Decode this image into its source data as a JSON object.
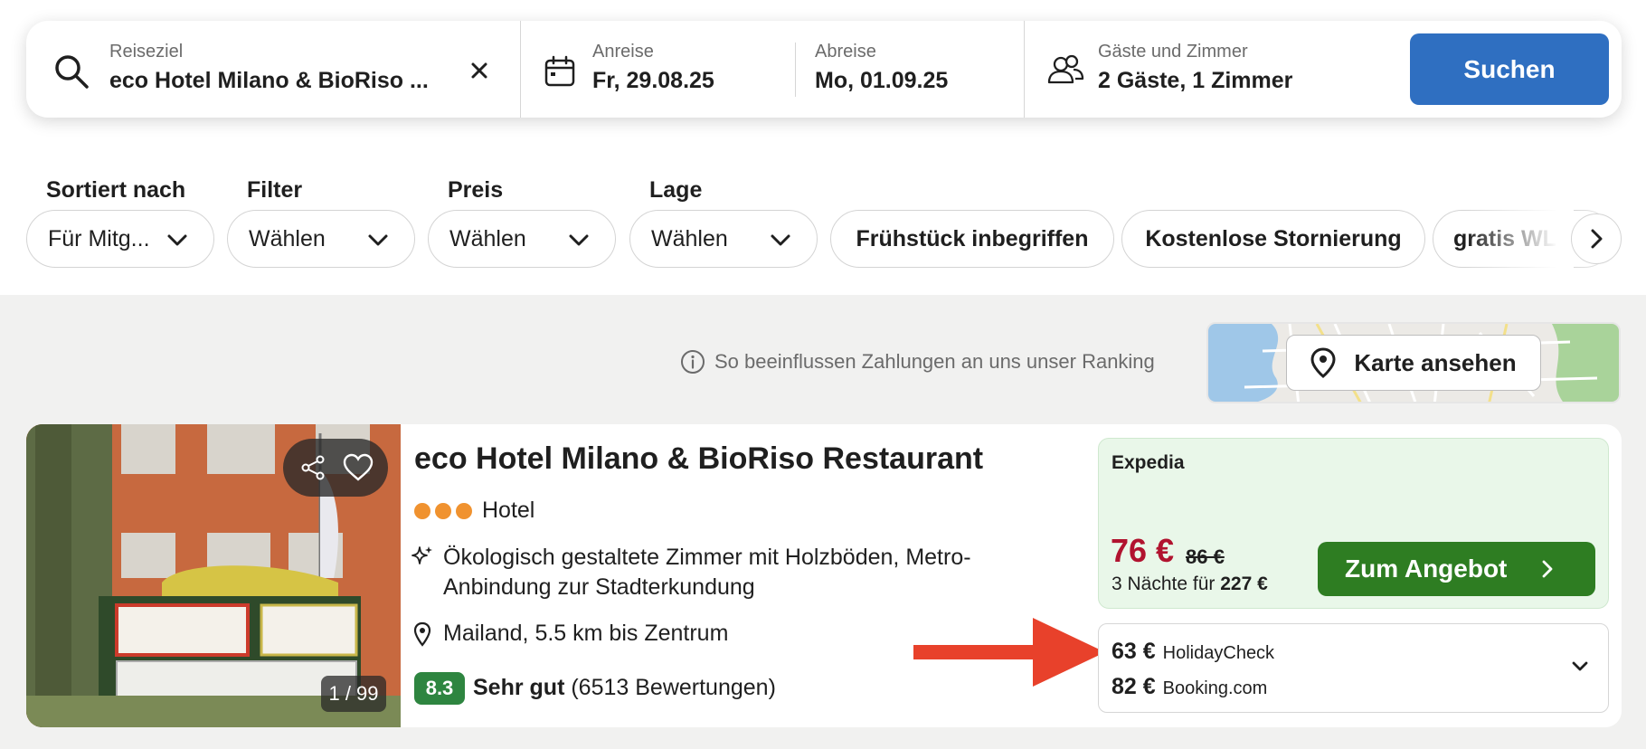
{
  "search": {
    "destination_label": "Reiseziel",
    "destination_value": "eco Hotel Milano & BioRiso ...",
    "checkin_label": "Anreise",
    "checkin_value": "Fr, 29.08.25",
    "checkout_label": "Abreise",
    "checkout_value": "Mo, 01.09.25",
    "guests_label": "Gäste und Zimmer",
    "guests_value": "2 Gäste, 1 Zimmer",
    "search_button": "Suchen"
  },
  "filters": {
    "sort_label": "Sortiert nach",
    "sort_value": "Für Mitg...",
    "filter_label": "Filter",
    "filter_value": "Wählen",
    "price_label": "Preis",
    "price_value": "Wählen",
    "location_label": "Lage",
    "location_value": "Wählen",
    "chips": [
      "Frühstück inbegriffen",
      "Kostenlose Stornierung",
      "gratis WLAN"
    ]
  },
  "ranking_info": "So beeinflussen Zahlungen an uns unser Ranking",
  "map_button": "Karte ansehen",
  "hotel": {
    "name": "eco Hotel Milano & BioRiso Restaurant",
    "stars": 3,
    "type": "Hotel",
    "feature": "Ökologisch gestaltete Zimmer mit Holzböden, Metro-Anbindung zur Stadterkundung",
    "location": "Mailand, 5.5 km bis Zentrum",
    "rating_score": "8.3",
    "rating_word": "Sehr gut",
    "rating_count": "(6513 Bewertungen)",
    "photo_counter": "1 / 99"
  },
  "offer": {
    "provider": "Expedia",
    "price": "76 €",
    "old_price": "86 €",
    "nights_prefix": "3 Nächte für",
    "nights_total": "227 €",
    "button": "Zum Angebot",
    "alternatives": [
      {
        "price": "63 €",
        "provider": "HolidayCheck"
      },
      {
        "price": "82 €",
        "provider": "Booking.com"
      }
    ]
  },
  "colors": {
    "primary_blue": "#2f6fc1",
    "offer_green": "#2e7d22",
    "price_red": "#b1132f",
    "rating_green": "#2e8540",
    "star_orange": "#f0922f",
    "arrow_red": "#e8412b"
  }
}
